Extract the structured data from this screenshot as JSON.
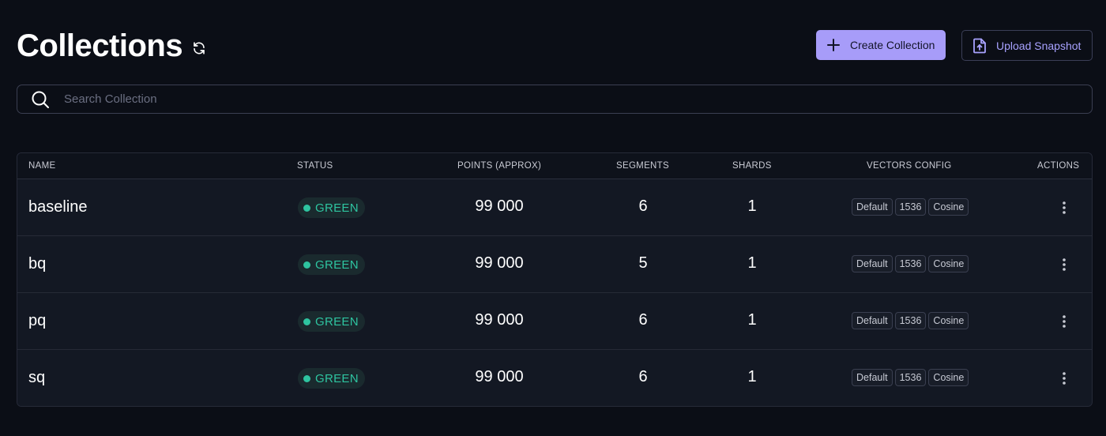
{
  "header": {
    "title": "Collections",
    "refresh_icon": "refresh-icon",
    "create_label": "Create Collection",
    "upload_label": "Upload Snapshot"
  },
  "search": {
    "placeholder": "Search Collection",
    "value": ""
  },
  "table": {
    "columns": [
      "NAME",
      "STATUS",
      "POINTS (APPROX)",
      "SEGMENTS",
      "SHARDS",
      "VECTORS CONFIG",
      "ACTIONS"
    ],
    "rows": [
      {
        "name": "baseline",
        "status": "GREEN",
        "points": "99 000",
        "segments": "6",
        "shards": "1",
        "vectors": [
          "Default",
          "1536",
          "Cosine"
        ]
      },
      {
        "name": "bq",
        "status": "GREEN",
        "points": "99 000",
        "segments": "5",
        "shards": "1",
        "vectors": [
          "Default",
          "1536",
          "Cosine"
        ]
      },
      {
        "name": "pq",
        "status": "GREEN",
        "points": "99 000",
        "segments": "6",
        "shards": "1",
        "vectors": [
          "Default",
          "1536",
          "Cosine"
        ]
      },
      {
        "name": "sq",
        "status": "GREEN",
        "points": "99 000",
        "segments": "6",
        "shards": "1",
        "vectors": [
          "Default",
          "1536",
          "Cosine"
        ]
      }
    ]
  },
  "colors": {
    "background": "#0b0e16",
    "accent": "#a79cf9",
    "status_green": "#2ec4a0"
  }
}
